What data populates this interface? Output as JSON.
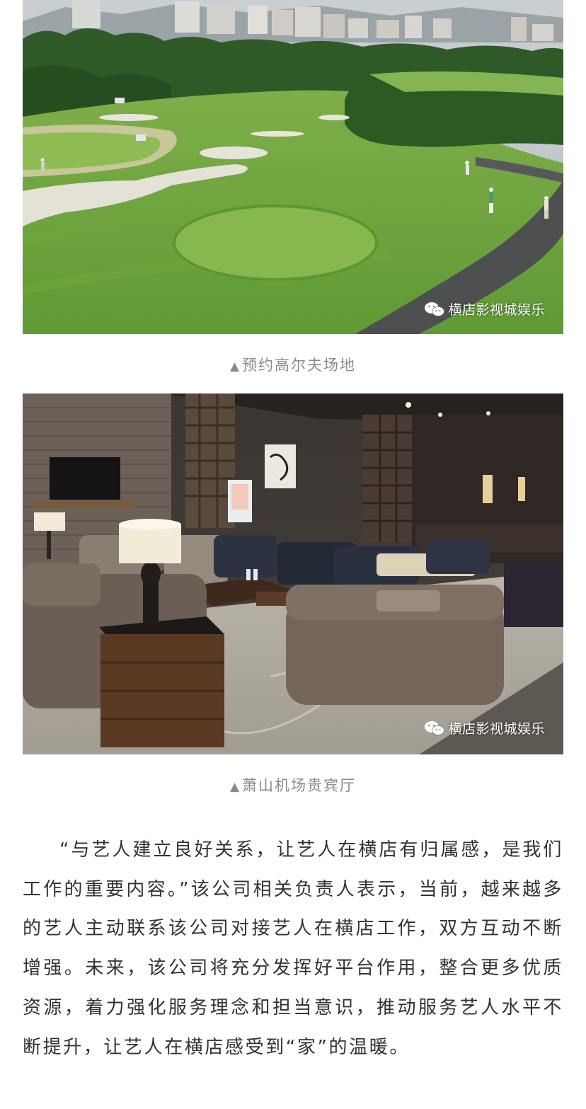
{
  "watermark": {
    "icon": "wechat-icon",
    "text": "横店影视城娱乐"
  },
  "figures": [
    {
      "caption_marker": "▲",
      "caption": "预约高尔夫场地"
    },
    {
      "caption_marker": "▲",
      "caption": "萧山机场贵宾厅"
    }
  ],
  "article": {
    "paragraph": "“与艺人建立良好关系，让艺人在横店有归属感，是我们工作的重要内容。”该公司相关负责人表示，当前，越来越多的艺人主动联系该公司对接艺人在横店工作，双方互动不断增强。未来，该公司将充分发挥好平台作用，整合更多优质资源，着力强化服务理念和担当意识，推动服务艺人水平不断提升，让艺人在横店感受到“家”的温暖。"
  },
  "colors": {
    "caption": "#8a8a8a",
    "body_text": "#333333"
  }
}
